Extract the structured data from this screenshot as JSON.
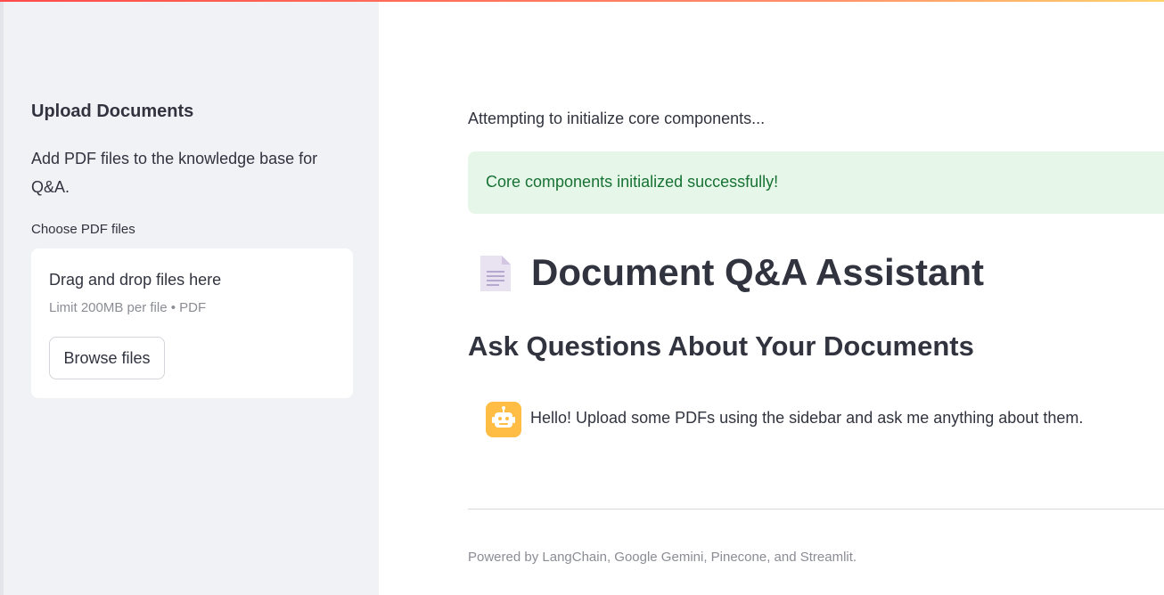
{
  "sidebar": {
    "heading": "Upload Documents",
    "description": "Add PDF files to the knowledge base for Q&A.",
    "uploader": {
      "label": "Choose PDF files",
      "drop_text": "Drag and drop files here",
      "limit_text": "Limit 200MB per file • PDF",
      "browse_label": "Browse files"
    }
  },
  "main": {
    "status_text": "Attempting to initialize core components...",
    "success_message": "Core components initialized successfully!",
    "title_icon": "document-icon",
    "title": "Document Q&A Assistant",
    "subtitle": "Ask Questions About Your Documents",
    "chat": [
      {
        "role": "assistant",
        "avatar_icon": "robot-icon",
        "message": "Hello! Upload some PDFs using the sidebar and ask me anything about them."
      }
    ],
    "footer": "Powered by LangChain, Google Gemini, Pinecone, and Streamlit."
  },
  "colors": {
    "sidebar_bg": "#f0f2f6",
    "success_bg": "#e6f7ea",
    "success_text": "#177233",
    "avatar_bg": "#ffbd45",
    "text": "#31333f",
    "muted_text": "#8b8d95"
  }
}
